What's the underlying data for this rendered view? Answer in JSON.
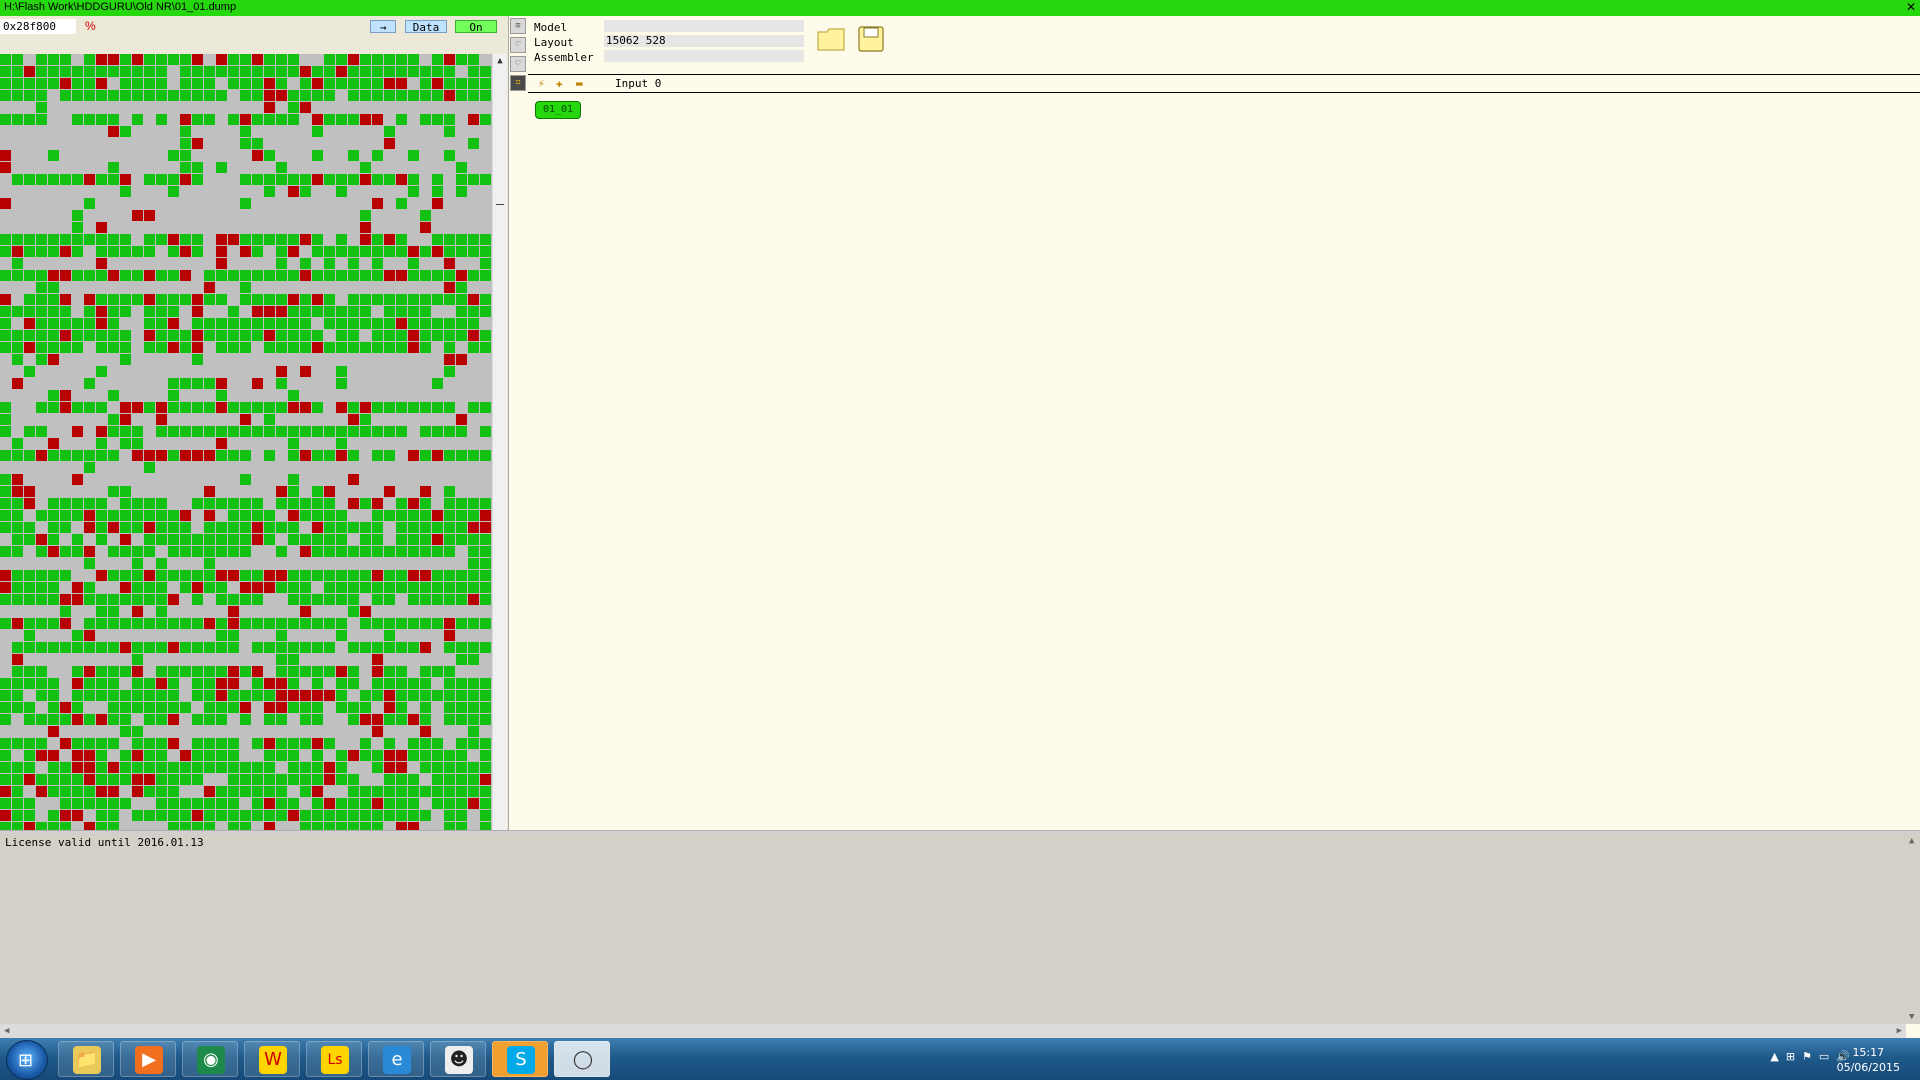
{
  "window": {
    "title": "H:\\Flash Work\\HDDGURU\\Old NR\\01_01.dump",
    "close_glyph": "✕"
  },
  "toolbar": {
    "address": "0x28f800",
    "percent": "%",
    "arrow_label": "→",
    "data_label": "Data",
    "on_label": "On"
  },
  "grid_legend": {
    "good_color": "#13c113",
    "bad_color": "#b80000",
    "empty_color": "#c0c0c0"
  },
  "properties": {
    "model_label": "Model",
    "model_value": "",
    "layout_label": "Layout",
    "layout_value": "15062 528",
    "assembler_label": "Assembler",
    "assembler_value": ""
  },
  "icons": {
    "folder": "folder-icon",
    "save": "save-icon"
  },
  "input_toolbar": {
    "wand": "⚡",
    "add": "✚",
    "remove": "▬",
    "input_label": "Input 0"
  },
  "node": {
    "label": "01_01"
  },
  "log": {
    "line1": "License valid until 2016.01.13"
  },
  "taskbar": {
    "apps": [
      {
        "name": "explorer",
        "glyph": "📁"
      },
      {
        "name": "media",
        "glyph": "▶"
      },
      {
        "name": "browser-green",
        "glyph": "◉"
      },
      {
        "name": "wow",
        "glyph": "W"
      },
      {
        "name": "ls",
        "glyph": "Ls"
      },
      {
        "name": "ie",
        "glyph": "e"
      },
      {
        "name": "cat",
        "glyph": "☻"
      },
      {
        "name": "skype",
        "glyph": "S"
      },
      {
        "name": "app-o",
        "glyph": "◯"
      }
    ],
    "time": "15:17",
    "date": "05/06/2015"
  }
}
